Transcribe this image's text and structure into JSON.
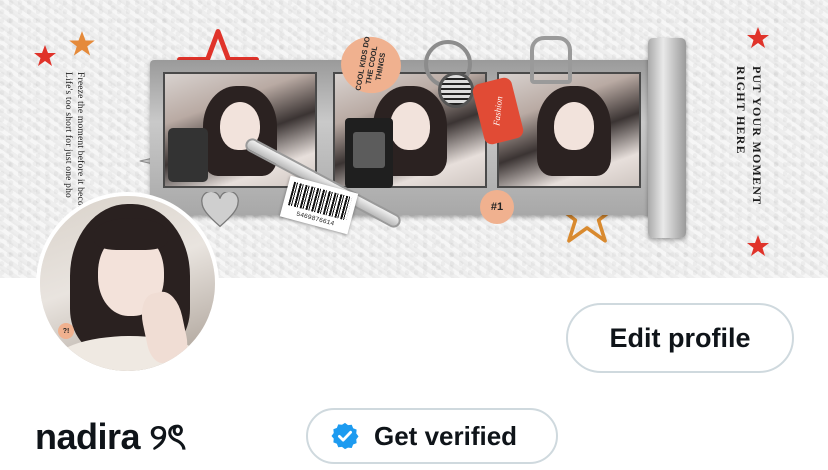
{
  "banner": {
    "left_text": "Freeze the moment before it become. memory. Life's too short for just one pho",
    "right_text": "PUT YOUR MOMENT RIGHT HERE",
    "oval_tag": "COOL KIDS DO THE COOL THINGS",
    "red_tag": "Fashion",
    "badge": "#1",
    "barcode_number": "5469876614",
    "colors": {
      "star_red": "#e0332a",
      "star_orange": "#e58a3a",
      "tag_peach": "#f0b18f",
      "tag_red": "#e14b35"
    }
  },
  "profile": {
    "avatar_badge": "?!",
    "edit_button_label": "Edit profile",
    "display_name": "nadira ୨ৎ",
    "verify_button_label": "Get verified",
    "verify_icon": "verified-check-badge-icon",
    "colors": {
      "verified_blue": "#1d9bf0",
      "text": "#0f1419",
      "button_border": "#cfd9de"
    }
  }
}
